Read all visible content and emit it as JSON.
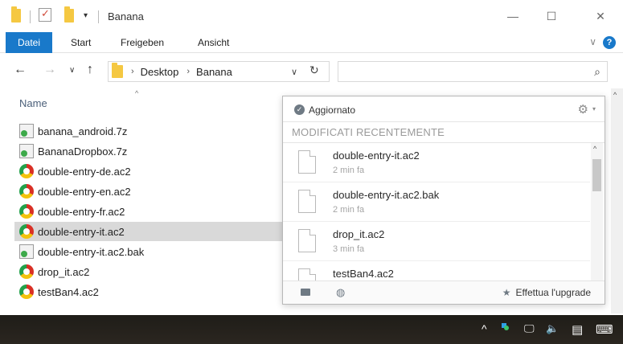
{
  "window": {
    "title": "Banana",
    "minimize_glyph": "—",
    "maximize_glyph": "☐",
    "close_glyph": "✕"
  },
  "ribbon": {
    "tabs": [
      "Datei",
      "Start",
      "Freigeben",
      "Ansicht"
    ],
    "expand_glyph": "∨",
    "help_label": "?"
  },
  "address": {
    "back_glyph": "←",
    "forward_glyph": "→",
    "recent_glyph": "∨",
    "up_glyph": "↑",
    "crumbs": [
      "Desktop",
      "Banana"
    ],
    "crumb_sep": "›",
    "dropdown_glyph": "∨",
    "refresh_glyph": "↻",
    "search_glyph": "⌕",
    "search_placeholder": ""
  },
  "list": {
    "column_name": "Name",
    "sort_glyph": "^",
    "files": [
      {
        "name": "banana_android.7z",
        "icon": "archive-7z-icon"
      },
      {
        "name": "BananaDropbox.7z",
        "icon": "archive-7z-icon"
      },
      {
        "name": "double-entry-de.ac2",
        "icon": "ac2-file-icon"
      },
      {
        "name": "double-entry-en.ac2",
        "icon": "ac2-file-icon"
      },
      {
        "name": "double-entry-fr.ac2",
        "icon": "ac2-file-icon"
      },
      {
        "name": "double-entry-it.ac2",
        "icon": "ac2-file-icon",
        "selected": true
      },
      {
        "name": "double-entry-it.ac2.bak",
        "icon": "bak-file-icon"
      },
      {
        "name": "drop_it.ac2",
        "icon": "ac2-file-icon"
      },
      {
        "name": "testBan4.ac2",
        "icon": "ac2-file-icon"
      }
    ]
  },
  "dropbox": {
    "status": "Aggiornato",
    "status_check": "✓",
    "gear_glyph": "⚙",
    "gear_caret": "▾",
    "section_title": "MODIFICATI RECENTEMENTE",
    "recent": [
      {
        "name": "double-entry-it.ac2",
        "time": "2 min fa"
      },
      {
        "name": "double-entry-it.ac2.bak",
        "time": "2 min fa"
      },
      {
        "name": "drop_it.ac2",
        "time": "3 min fa"
      },
      {
        "name": "testBan4.ac2",
        "time": ""
      }
    ],
    "scroll_up_glyph": "^",
    "globe_glyph": "◍",
    "star_glyph": "★",
    "upgrade_label": "Effettua l'upgrade"
  },
  "taskbar": {
    "tray_up_glyph": "^",
    "network_glyph": "🖵",
    "volume_glyph": "🔈",
    "notification_glyph": "▤",
    "keyboard_glyph": "⌨"
  },
  "colors": {
    "accent": "#1979ca",
    "selected_row": "#d9d9d9",
    "folder": "#f5c842",
    "taskbar": "#1f1d18"
  }
}
